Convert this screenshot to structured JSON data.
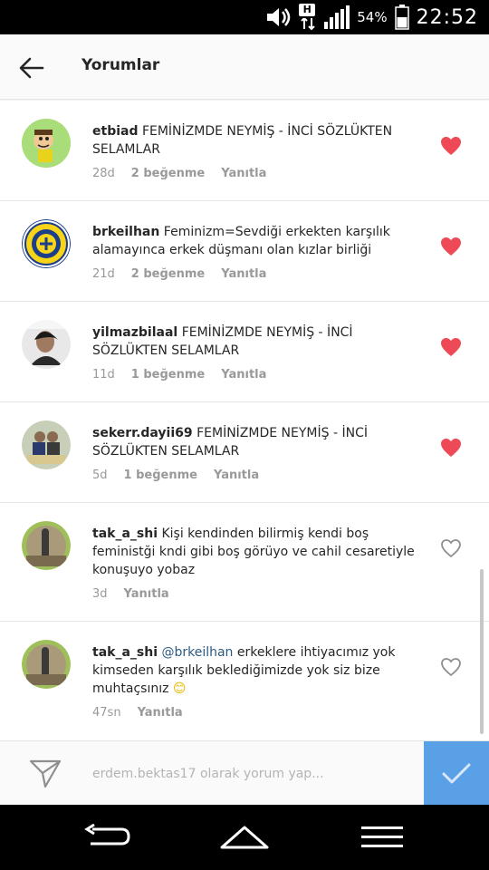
{
  "status_bar": {
    "network": "H",
    "battery": "54%",
    "time": "22:52"
  },
  "header": {
    "title": "Yorumlar"
  },
  "comments": [
    {
      "username": "etbiad",
      "text": "FEMİNİZMDE NEYMİŞ - İNCİ SÖZLÜKTEN SELAMLAR",
      "mention": "",
      "emoji": "",
      "time": "28d",
      "likes": "2 beğenme",
      "reply": "Yanıtla",
      "liked": true
    },
    {
      "username": "brkeilhan",
      "text": "Feminizm=Sevdiği erkekten karşılık alamayınca erkek düşmanı olan kızlar birliği",
      "mention": "",
      "emoji": "",
      "time": "21d",
      "likes": "2 beğenme",
      "reply": "Yanıtla",
      "liked": true
    },
    {
      "username": "yilmazbilaal",
      "text": "FEMİNİZMDE NEYMİŞ - İNCİ SÖZLÜKTEN SELAMLAR",
      "mention": "",
      "emoji": "",
      "time": "11d",
      "likes": "1 beğenme",
      "reply": "Yanıtla",
      "liked": true
    },
    {
      "username": "sekerr.dayii69",
      "text": "FEMİNİZMDE NEYMİŞ - İNCİ SÖZLÜKTEN SELAMLAR",
      "mention": "",
      "emoji": "",
      "time": "5d",
      "likes": "1 beğenme",
      "reply": "Yanıtla",
      "liked": true
    },
    {
      "username": "tak_a_shi",
      "text": "Kişi kendinden bilirmiş kendi boş feministği kndi gibi boş görüyo ve cahil cesaretiyle konuşuyo yobaz",
      "mention": "",
      "emoji": "",
      "time": "3d",
      "likes": "",
      "reply": "Yanıtla",
      "liked": false
    },
    {
      "username": "tak_a_shi",
      "text": "erkeklere ihtiyacımız yok kimseden karşılık beklediğimizde yok siz bize muhtaçsınız",
      "mention": "@brkeilhan",
      "emoji": "😊",
      "time": "47sn",
      "likes": "",
      "reply": "Yanıtla",
      "liked": false
    }
  ],
  "input": {
    "placeholder": "erdem.bektas17 olarak yorum yap..."
  },
  "colors": {
    "like_red": "#ed4956",
    "post_button_blue": "#5aa0e6",
    "mention_blue": "#2b5a83",
    "meta_gray": "#999999"
  }
}
